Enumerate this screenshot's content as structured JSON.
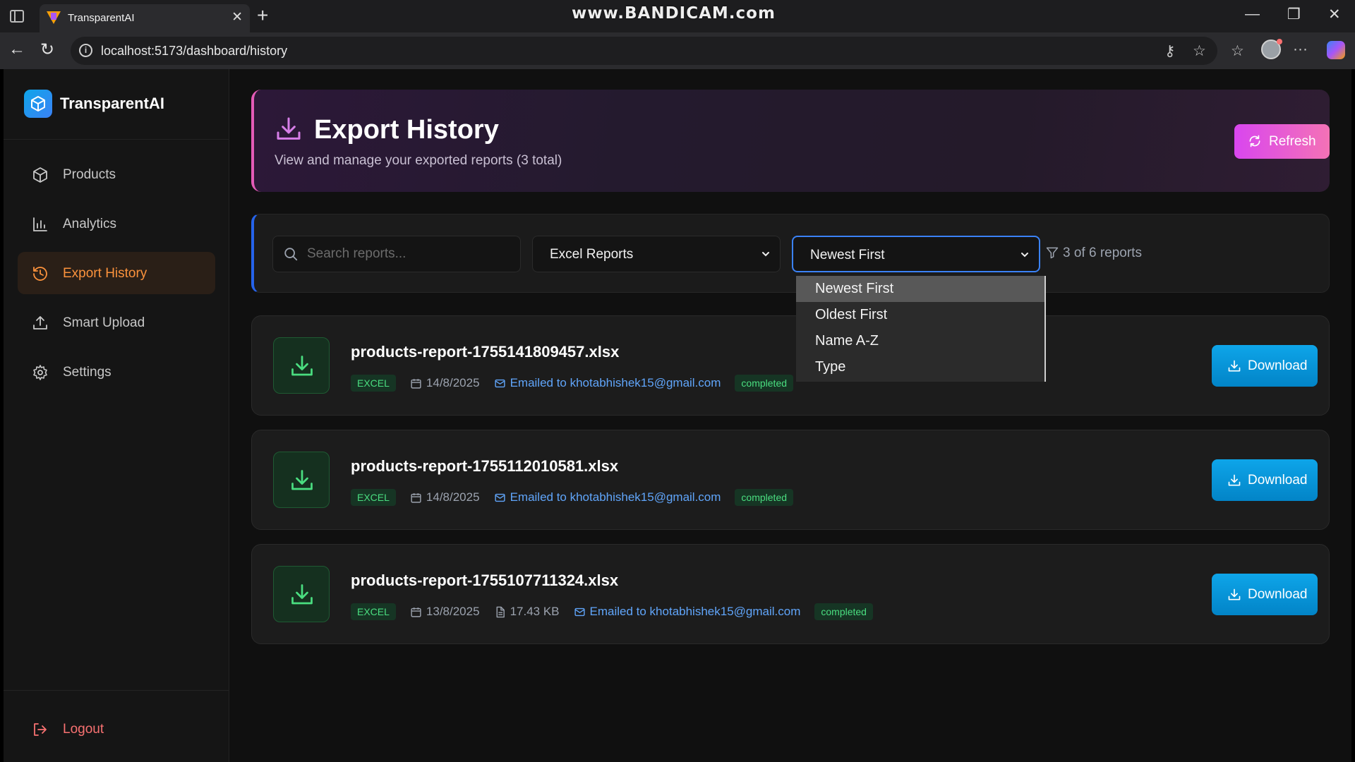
{
  "browser": {
    "tab_title": "TransparentAI",
    "url": "localhost:5173/dashboard/history",
    "watermark": "www.BANDICAM.com"
  },
  "sidebar": {
    "brand": "TransparentAI",
    "items": [
      {
        "label": "Products",
        "icon": "box-icon"
      },
      {
        "label": "Analytics",
        "icon": "bar-chart-icon"
      },
      {
        "label": "Export History",
        "icon": "history-icon",
        "active": true
      },
      {
        "label": "Smart Upload",
        "icon": "upload-icon"
      },
      {
        "label": "Settings",
        "icon": "gear-icon"
      }
    ],
    "logout": "Logout"
  },
  "header": {
    "title": "Export History",
    "subtitle": "View and manage your exported reports (3 total)",
    "refresh_label": "Refresh"
  },
  "filters": {
    "search_placeholder": "Search reports...",
    "type_filter": "Excel Reports",
    "sort": "Newest First",
    "count_text": "3 of 6 reports",
    "sort_options": [
      "Newest First",
      "Oldest First",
      "Name A-Z",
      "Type"
    ]
  },
  "reports": [
    {
      "name": "products-report-1755141809457.xlsx",
      "type": "EXCEL",
      "date": "14/8/2025",
      "size": "",
      "email": "Emailed to khotabhishek15@gmail.com",
      "status": "completed",
      "download_label": "Download"
    },
    {
      "name": "products-report-1755112010581.xlsx",
      "type": "EXCEL",
      "date": "14/8/2025",
      "size": "",
      "email": "Emailed to khotabhishek15@gmail.com",
      "status": "completed",
      "download_label": "Download"
    },
    {
      "name": "products-report-1755107711324.xlsx",
      "type": "EXCEL",
      "date": "13/8/2025",
      "size": "17.43 KB",
      "email": "Emailed to khotabhishek15@gmail.com",
      "status": "completed",
      "download_label": "Download"
    }
  ],
  "colors": {
    "accent_orange": "#fb923c",
    "accent_pink": "#e35bb7",
    "accent_blue": "#0ea5e9",
    "status_green": "#4ade80"
  }
}
